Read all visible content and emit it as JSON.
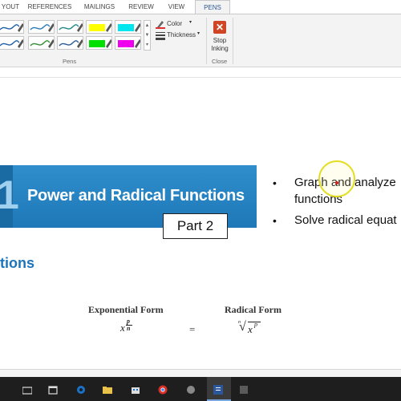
{
  "ribbon": {
    "tabs": [
      "YOUT",
      "REFERENCES",
      "MAILINGS",
      "REVIEW",
      "VIEW",
      "PENS"
    ],
    "active_tab": "PENS",
    "pens": [
      {
        "color": "#1f5fa8",
        "type": "pen"
      },
      {
        "color": "#2a7ab8",
        "type": "pen"
      },
      {
        "color": "#1f8a8a",
        "type": "pen"
      },
      {
        "color": "#ffff00",
        "type": "highlighter"
      },
      {
        "color": "#00e5ee",
        "type": "highlighter"
      },
      {
        "color": "#1f5fa8",
        "type": "pen"
      },
      {
        "color": "#2f8f2f",
        "type": "pen"
      },
      {
        "color": "#2a5a9a",
        "type": "pen"
      },
      {
        "color": "#00e000",
        "type": "highlighter"
      },
      {
        "color": "#ee00ee",
        "type": "highlighter"
      }
    ],
    "color_label": "Color",
    "thickness_label": "Thickness",
    "pens_group_label": "Pens",
    "stop_inking_line1": "Stop",
    "stop_inking_line2": "Inking",
    "close_group_label": "Close"
  },
  "slide": {
    "chapter_number": "1",
    "banner_title": "Power and Radical Functions",
    "part_label": "Part 2",
    "bullets": [
      {
        "line1": "Graph and analyze",
        "line2": "functions"
      },
      {
        "line1": "Solve radical equat",
        "line2": ""
      }
    ],
    "section_title": "tions",
    "exponential_heading": "Exponential Form",
    "radical_heading": "Radical Form",
    "exp_numerator": "p",
    "exp_denominator": "n",
    "exp_base": "x",
    "equals": "=",
    "rad_index": "n",
    "rad_base": "x",
    "rad_exponent": "p",
    "radical_symbol": "√"
  },
  "colors": {
    "banner_blue": "#2f8ecb",
    "section_blue": "#1b75bc",
    "stop_icon_red": "#d04525",
    "pointer_yellow": "#e4dd22",
    "pointer_red": "#d32222"
  },
  "taskbar": {
    "icons": [
      "start-icon",
      "file-explorer-icon",
      "edge-icon",
      "folder-icon",
      "store-icon",
      "chrome-icon",
      "app-icon",
      "word-icon",
      "app-icon-2"
    ]
  }
}
